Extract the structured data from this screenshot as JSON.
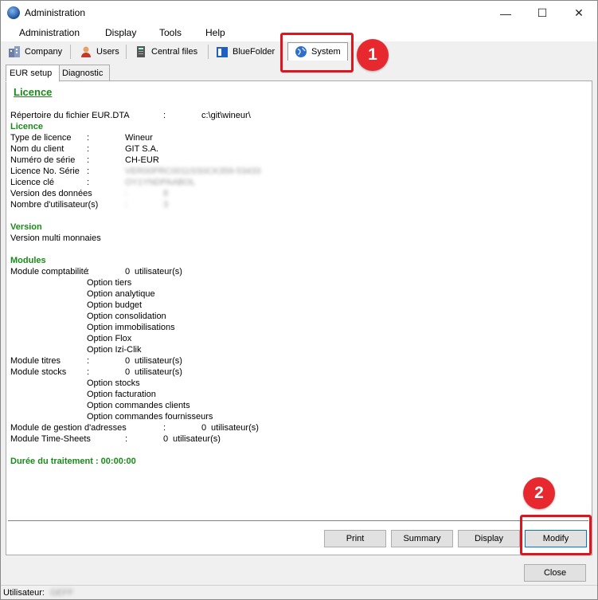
{
  "window": {
    "title": "Administration",
    "minimize_glyph": "—",
    "maximize_glyph": "☐",
    "close_glyph": "✕"
  },
  "menu": [
    "Administration",
    "Display",
    "Tools",
    "Help"
  ],
  "toolbar_tabs": [
    {
      "label": "Company",
      "icon": "building-icon"
    },
    {
      "label": "Users",
      "icon": "user-icon"
    },
    {
      "label": "Central files",
      "icon": "server-icon"
    },
    {
      "label": "BlueFolder",
      "icon": "blue-folder-icon"
    },
    {
      "label": "System",
      "icon": "globe-icon"
    }
  ],
  "annotations": {
    "badge1": "1",
    "badge2": "2"
  },
  "sub_tabs": [
    "EUR setup",
    "Diagnostic"
  ],
  "report": {
    "heading": "Licence",
    "file_row": {
      "label": "Répertoire du fichier EUR.DTA",
      "sep": ":",
      "value": "c:\\git\\wineur\\"
    },
    "licence_section": "Licence",
    "licence_rows": [
      {
        "label": "Type de licence",
        "sep": ":",
        "value": "Wineur"
      },
      {
        "label": "Nom du client",
        "sep": ":",
        "value": "GIT S.A."
      },
      {
        "label": "Numéro de série",
        "sep": ":",
        "value": "CH-EUR"
      },
      {
        "label": "Licence No. Série",
        "sep": ":",
        "value": "VER00PRC0011SS0CK359-53433"
      },
      {
        "label": "Licence clé",
        "sep": ":",
        "value": "OY1YNDPAABOL"
      },
      {
        "label": "Version des données",
        "sep": ":",
        "value": "8"
      },
      {
        "label": "Nombre d'utilisateur(s)",
        "sep": ":",
        "value": "3"
      }
    ],
    "version_section": "Version",
    "version_value": "Version multi monnaies",
    "modules_section": "Modules",
    "module_compta": {
      "label": "Module comptabilité",
      "sep": ":",
      "count": "0",
      "unit": "utilisateur(s)"
    },
    "compta_options": [
      "Option tiers",
      "Option analytique",
      "Option budget",
      "Option consolidation",
      "Option immobilisations",
      "Option Flox",
      "Option Izi-Clik"
    ],
    "module_titres": {
      "label": "Module titres",
      "sep": ":",
      "count": "0",
      "unit": "utilisateur(s)"
    },
    "module_stocks": {
      "label": "Module stocks",
      "sep": ":",
      "count": "0",
      "unit": "utilisateur(s)"
    },
    "stocks_options": [
      "Option stocks",
      "Option facturation",
      "Option commandes clients",
      "Option commandes fournisseurs"
    ],
    "module_adresses": {
      "label": "Module de gestion d'adresses",
      "sep": ":",
      "count": "0",
      "unit": "utilisateur(s)"
    },
    "module_timesheets": {
      "label": "Module Time-Sheets",
      "sep": ":",
      "count": "0",
      "unit": "utilisateur(s)"
    },
    "duration": "Durée du traitement : 00:00:00"
  },
  "buttons": {
    "print": "Print",
    "summary": "Summary",
    "display": "Display",
    "modify": "Modify",
    "close": "Close"
  },
  "status": {
    "user_label": "Utilisateur:",
    "user_value": "GEFF"
  },
  "colors": {
    "accent_green": "#1a8a1a",
    "annotation_red": "#e0141e",
    "focus_blue": "#0078d7"
  }
}
